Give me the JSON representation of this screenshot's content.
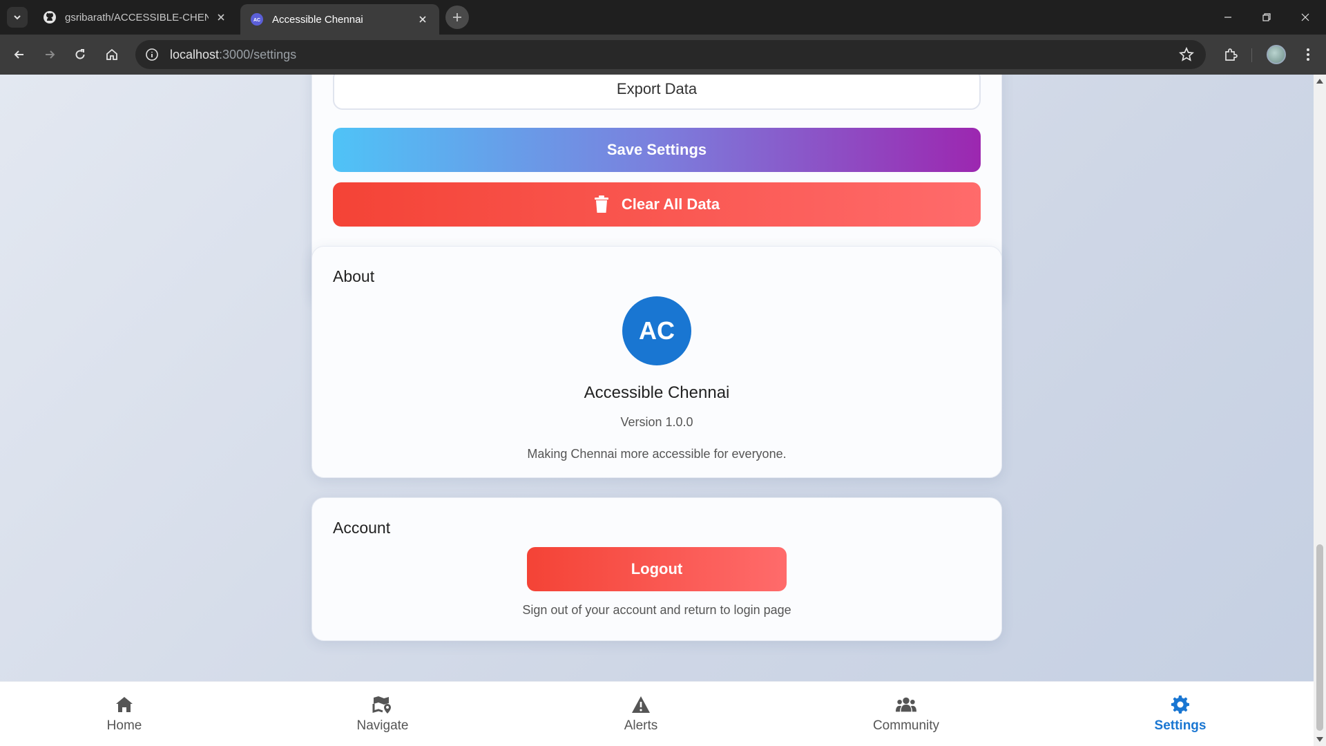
{
  "browser": {
    "tabs": [
      {
        "title": "gsribarath/ACCESSIBLE-CHENN",
        "active": false
      },
      {
        "title": "Accessible Chennai",
        "active": true
      }
    ],
    "favicon_text": "AC",
    "url_host": "localhost",
    "url_path": ":3000/settings"
  },
  "settings_card": {
    "export_label": "Export Data",
    "save_label": "Save Settings",
    "clear_label": "Clear All Data"
  },
  "about": {
    "title": "About",
    "logo_text": "AC",
    "app_name": "Accessible Chennai",
    "version": "Version 1.0.0",
    "tagline": "Making Chennai more accessible for everyone."
  },
  "account": {
    "title": "Account",
    "logout_label": "Logout",
    "logout_description": "Sign out of your account and return to login page"
  },
  "bottom_nav": {
    "items": [
      {
        "label": "Home",
        "icon": "home-icon"
      },
      {
        "label": "Navigate",
        "icon": "map-pin-icon"
      },
      {
        "label": "Alerts",
        "icon": "warning-icon"
      },
      {
        "label": "Community",
        "icon": "users-icon"
      },
      {
        "label": "Settings",
        "icon": "gear-icon",
        "active": true
      }
    ]
  },
  "colors": {
    "primary": "#1976d2",
    "danger_start": "#f44336",
    "danger_end": "#ff6b6b",
    "save_gradient_start": "#4fc3f7",
    "save_gradient_end": "#9c27b0"
  }
}
